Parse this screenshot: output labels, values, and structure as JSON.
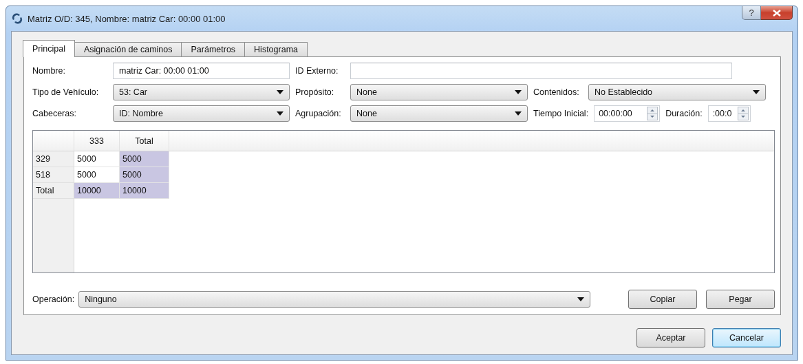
{
  "window": {
    "title": "Matriz O/D: 345, Nombre: matriz Car: 00:00 01:00",
    "help": "?"
  },
  "tabs": [
    {
      "label": "Principal",
      "selected": true
    },
    {
      "label": "Asignación de caminos",
      "selected": false
    },
    {
      "label": "Parámetros",
      "selected": false
    },
    {
      "label": "Histograma",
      "selected": false
    }
  ],
  "form": {
    "nombre": {
      "label": "Nombre:",
      "value": "matriz Car: 00:00 01:00"
    },
    "id_externo": {
      "label": "ID Externo:"
    },
    "tipo_vehiculo": {
      "label": "Tipo de Vehículo:",
      "value": "53: Car"
    },
    "proposito": {
      "label": "Propósito:",
      "value": "None"
    },
    "contenidos": {
      "label": "Contenidos:",
      "value": "No Establecido"
    },
    "cabeceras": {
      "label": "Cabeceras:",
      "value": "ID: Nombre"
    },
    "agrupacion": {
      "label": "Agrupación:",
      "value": "None"
    },
    "tiempo_inicial": {
      "label": "Tiempo Inicial:",
      "value": "00:00:00"
    },
    "duracion": {
      "label": "Duración:",
      "value": ":00:0"
    }
  },
  "table": {
    "columns": [
      "333",
      "Total"
    ],
    "rows": [
      {
        "header": "329",
        "cells": [
          {
            "text": "5000",
            "selected": false
          },
          {
            "text": "5000",
            "selected": true
          }
        ]
      },
      {
        "header": "518",
        "cells": [
          {
            "text": "5000",
            "selected": false
          },
          {
            "text": "5000",
            "selected": true
          }
        ]
      },
      {
        "header": "Total",
        "cells": [
          {
            "text": "10000",
            "selected": true
          },
          {
            "text": "10000",
            "selected": true
          }
        ]
      }
    ]
  },
  "operacion": {
    "label": "Operación:",
    "value": "Ninguno"
  },
  "edit_buttons": [
    {
      "label": "Copiar",
      "default": false
    },
    {
      "label": "Pegar",
      "default": false
    }
  ],
  "dialog_buttons": [
    {
      "label": "Aceptar",
      "default": false
    },
    {
      "label": "Cancelar",
      "default": true
    }
  ]
}
